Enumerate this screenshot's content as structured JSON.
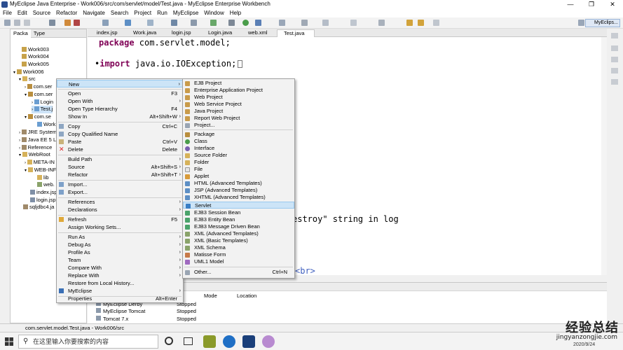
{
  "window": {
    "title": "MyEclipse Java Enterprise - Work006/src/com/servlet/model/Test.java - MyEclipse Enterprise Workbench",
    "minimize": "—",
    "maximize": "❐",
    "close": "✕"
  },
  "menubar": [
    "File",
    "Edit",
    "Source",
    "Refactor",
    "Navigate",
    "Search",
    "Project",
    "Run",
    "MyEclipse",
    "Window",
    "Help"
  ],
  "toolbar": {
    "perspective": "MyEclips..."
  },
  "left_panel": {
    "tabs": [
      "Packa",
      "Type"
    ],
    "tree": [
      "Work003",
      "Work004",
      "Work005",
      "Work006",
      "src",
      "com.ser",
      "com.ser",
      "Login",
      "Test.j",
      "com.se",
      "Work",
      "JRE System",
      "Java EE 5 L",
      "Reference",
      "WebRoot",
      "META-IN",
      "WEB-INF",
      "lib",
      "web.",
      "index.jsp",
      "login.jsp",
      "sqljdbc4.ja"
    ]
  },
  "editor_tabs": [
    "index.jsp",
    "Work.java",
    "login.jsp",
    "Login.java",
    "web.xml",
    "Test.java"
  ],
  "editor": {
    "line1_kw": "package",
    "line1_rest": " com.servlet.model;",
    "line2_kw": "import",
    "line2_rest": " java.io.IOException;",
    "frag1": "estroy\" string in log",
    "frag2": "<br>"
  },
  "bottom_panel": {
    "headers": [
      "Mode",
      "Location"
    ],
    "servers": [
      {
        "name": "MyEclipse Derby",
        "status": "Stopped"
      },
      {
        "name": "MyEclipse Tomcat",
        "status": "Stopped"
      },
      {
        "name": "Tomcat  7.x",
        "status": "Stopped"
      }
    ]
  },
  "status_bar": {
    "text": "com.servlet.model.Test.java - Work006/src"
  },
  "context_menu": [
    {
      "label": "New",
      "shortcut": "",
      "arrow": "›"
    },
    {
      "label": "Open",
      "shortcut": "F3",
      "arrow": ""
    },
    {
      "label": "Open With",
      "shortcut": "",
      "arrow": "›"
    },
    {
      "label": "Open Type Hierarchy",
      "shortcut": "F4",
      "arrow": ""
    },
    {
      "label": "Show In",
      "shortcut": "Alt+Shift+W",
      "arrow": "›"
    },
    {
      "label": "Copy",
      "shortcut": "Ctrl+C",
      "arrow": ""
    },
    {
      "label": "Copy Qualified Name",
      "shortcut": "",
      "arrow": ""
    },
    {
      "label": "Paste",
      "shortcut": "Ctrl+V",
      "arrow": ""
    },
    {
      "label": "Delete",
      "shortcut": "Delete",
      "arrow": ""
    },
    {
      "label": "Build Path",
      "shortcut": "",
      "arrow": "›"
    },
    {
      "label": "Source",
      "shortcut": "Alt+Shift+S",
      "arrow": "›"
    },
    {
      "label": "Refactor",
      "shortcut": "Alt+Shift+T",
      "arrow": "›"
    },
    {
      "label": "Import...",
      "shortcut": "",
      "arrow": ""
    },
    {
      "label": "Export...",
      "shortcut": "",
      "arrow": ""
    },
    {
      "label": "References",
      "shortcut": "",
      "arrow": "›"
    },
    {
      "label": "Declarations",
      "shortcut": "",
      "arrow": "›"
    },
    {
      "label": "Refresh",
      "shortcut": "F5",
      "arrow": ""
    },
    {
      "label": "Assign Working Sets...",
      "shortcut": "",
      "arrow": ""
    },
    {
      "label": "Run As",
      "shortcut": "",
      "arrow": "›"
    },
    {
      "label": "Debug As",
      "shortcut": "",
      "arrow": "›"
    },
    {
      "label": "Profile As",
      "shortcut": "",
      "arrow": "›"
    },
    {
      "label": "Team",
      "shortcut": "",
      "arrow": "›"
    },
    {
      "label": "Compare With",
      "shortcut": "",
      "arrow": "›"
    },
    {
      "label": "Replace With",
      "shortcut": "",
      "arrow": "›"
    },
    {
      "label": "Restore from Local History...",
      "shortcut": "",
      "arrow": ""
    },
    {
      "label": "MyEclipse",
      "shortcut": "",
      "arrow": "›"
    },
    {
      "label": "Properties",
      "shortcut": "Alt+Enter",
      "arrow": ""
    }
  ],
  "submenu_new": [
    {
      "label": "EJB Project",
      "shortcut": ""
    },
    {
      "label": "Enterprise Application Project",
      "shortcut": ""
    },
    {
      "label": "Web Project",
      "shortcut": ""
    },
    {
      "label": "Web Service Project",
      "shortcut": ""
    },
    {
      "label": "Java Project",
      "shortcut": ""
    },
    {
      "label": "Report Web Project",
      "shortcut": ""
    },
    {
      "label": "Project...",
      "shortcut": ""
    },
    {
      "label": "Package",
      "shortcut": ""
    },
    {
      "label": "Class",
      "shortcut": ""
    },
    {
      "label": "Interface",
      "shortcut": ""
    },
    {
      "label": "Source Folder",
      "shortcut": ""
    },
    {
      "label": "Folder",
      "shortcut": ""
    },
    {
      "label": "File",
      "shortcut": ""
    },
    {
      "label": "Applet",
      "shortcut": ""
    },
    {
      "label": "HTML (Advanced Templates)",
      "shortcut": ""
    },
    {
      "label": "JSP (Advanced Templates)",
      "shortcut": ""
    },
    {
      "label": "XHTML (Advanced Templates)",
      "shortcut": ""
    },
    {
      "label": "Servlet",
      "shortcut": ""
    },
    {
      "label": "EJB3 Session Bean",
      "shortcut": ""
    },
    {
      "label": "EJB3 Entity Bean",
      "shortcut": ""
    },
    {
      "label": "EJB3 Message Driven Bean",
      "shortcut": ""
    },
    {
      "label": "XML (Advanced Templates)",
      "shortcut": ""
    },
    {
      "label": "XML (Basic Templates)",
      "shortcut": ""
    },
    {
      "label": "XML Schema",
      "shortcut": ""
    },
    {
      "label": "Matisse Form",
      "shortcut": ""
    },
    {
      "label": "UML1 Model",
      "shortcut": ""
    },
    {
      "label": "Other...",
      "shortcut": "Ctrl+N"
    }
  ],
  "taskbar": {
    "search_placeholder": "在这里输入你要搜索的内容",
    "date": "2020/9/24"
  },
  "watermark": {
    "line1": "经验总结",
    "line2": "jingyanzongjie.com"
  },
  "colors": {
    "keyword": "#7f0055",
    "highlight": "#cce4f7",
    "menu_bg": "#f2f2f2"
  }
}
